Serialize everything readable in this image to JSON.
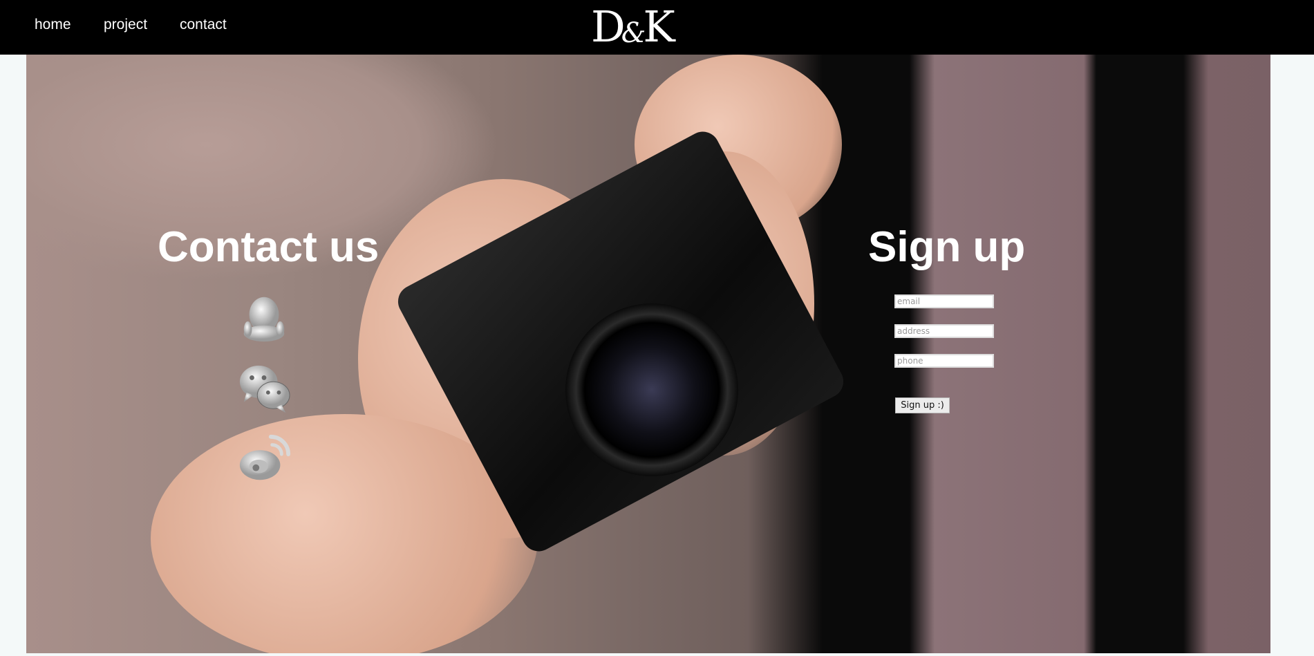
{
  "header": {
    "nav": [
      {
        "label": "home"
      },
      {
        "label": "project"
      },
      {
        "label": "contact"
      }
    ],
    "logo": "D&K"
  },
  "contact": {
    "title": "Contact us",
    "icons": [
      "qq-icon",
      "wechat-icon",
      "weibo-icon"
    ]
  },
  "signup": {
    "title": "Sign up",
    "fields": [
      {
        "placeholder": "email"
      },
      {
        "placeholder": "address"
      },
      {
        "placeholder": "phone"
      }
    ],
    "button_label": "Sign up :)"
  },
  "colors": {
    "header_bg": "#000000",
    "text": "#ffffff",
    "page_bg": "#f4f9f9"
  }
}
